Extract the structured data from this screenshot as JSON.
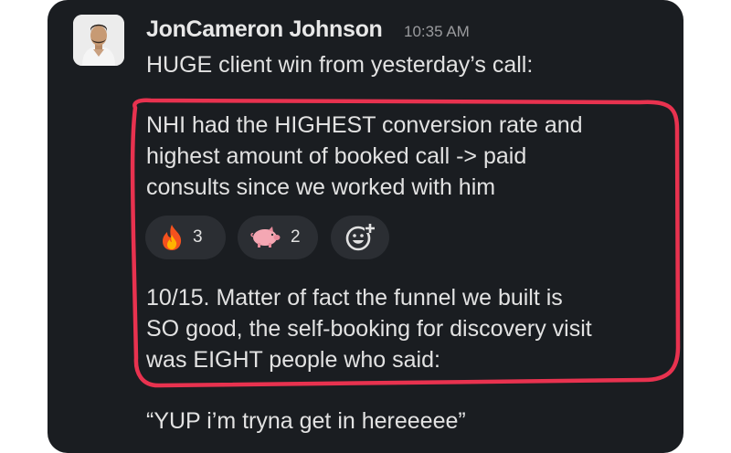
{
  "message": {
    "author": "JonCameron Johnson",
    "timestamp": "10:35 AM",
    "lines": [
      "HUGE client win from yesterday’s call:",
      "NHI had the HIGHEST conversion rate and",
      "highest amount of booked call -> paid",
      "consults since we worked with him",
      "10/15. Matter of fact the funnel we built is",
      "SO good, the self-booking for discovery visit",
      "was EIGHT people who said:",
      "“YUP i’m tryna get in hereeeee”"
    ]
  },
  "reactions": [
    {
      "icon": "fire-emoji-icon",
      "count": "3"
    },
    {
      "icon": "pig-emoji-icon",
      "count": "2"
    }
  ],
  "add_reaction_icon": "add-reaction-icon",
  "colors": {
    "card_background": "#1a1d21",
    "highlight_outline": "#e8324f",
    "reaction_pill": "#2b2e33"
  }
}
